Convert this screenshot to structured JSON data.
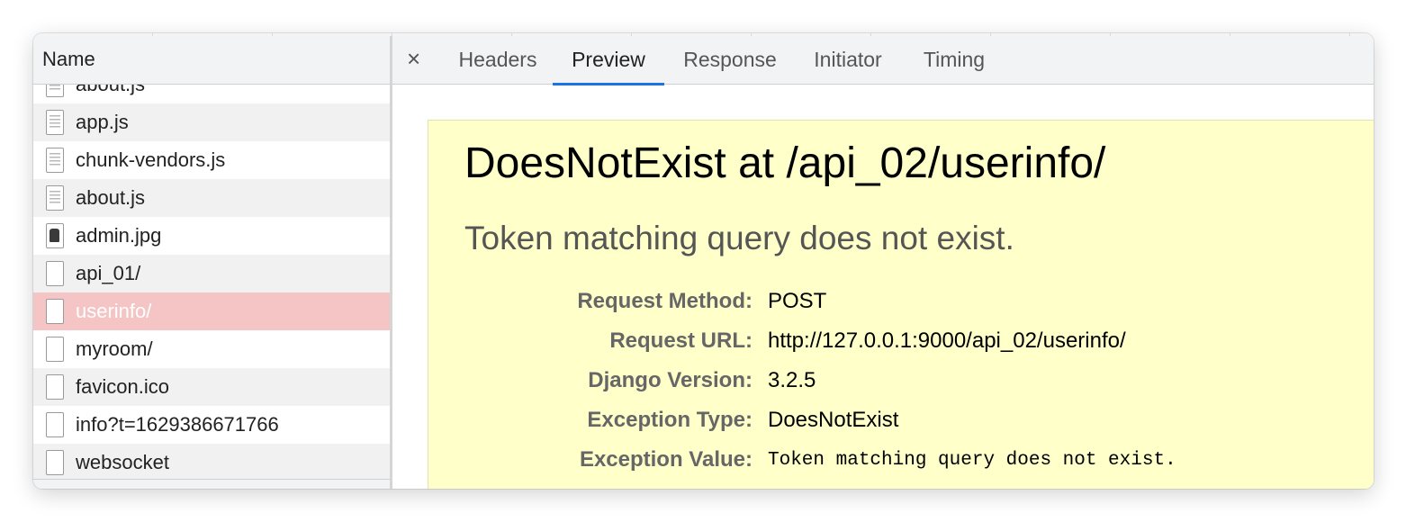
{
  "files_panel": {
    "column_header": "Name",
    "partial_top_item": "about.js",
    "items": [
      {
        "name": "app.js",
        "icon": "js-file-icon"
      },
      {
        "name": "chunk-vendors.js",
        "icon": "js-file-icon"
      },
      {
        "name": "about.js",
        "icon": "js-file-icon"
      },
      {
        "name": "admin.jpg",
        "icon": "image-file-icon"
      },
      {
        "name": "api_01/",
        "icon": "document-icon"
      },
      {
        "name": "userinfo/",
        "icon": "document-icon",
        "selected": true
      },
      {
        "name": "myroom/",
        "icon": "document-icon"
      },
      {
        "name": "favicon.ico",
        "icon": "document-icon"
      },
      {
        "name": "info?t=1629386671766",
        "icon": "document-icon"
      },
      {
        "name": "websocket",
        "icon": "document-icon"
      }
    ]
  },
  "details": {
    "close_symbol": "×",
    "tabs": [
      "Headers",
      "Preview",
      "Response",
      "Initiator",
      "Timing"
    ],
    "active_tab": "Preview",
    "error": {
      "title": "DoesNotExist at /api_02/userinfo/",
      "subtitle": "Token matching query does not exist.",
      "meta": [
        {
          "label": "Request Method:",
          "value": "POST"
        },
        {
          "label": "Request URL:",
          "value": "http://127.0.0.1:9000/api_02/userinfo/"
        },
        {
          "label": "Django Version:",
          "value": "3.2.5"
        },
        {
          "label": "Exception Type:",
          "value": "DoesNotExist"
        },
        {
          "label": "Exception Value:",
          "value": "Token matching query does not exist."
        }
      ]
    }
  },
  "colors": {
    "selected_row": "#f5c4c4",
    "active_tab_underline": "#1a73e8",
    "error_background": "#ffffc9"
  }
}
